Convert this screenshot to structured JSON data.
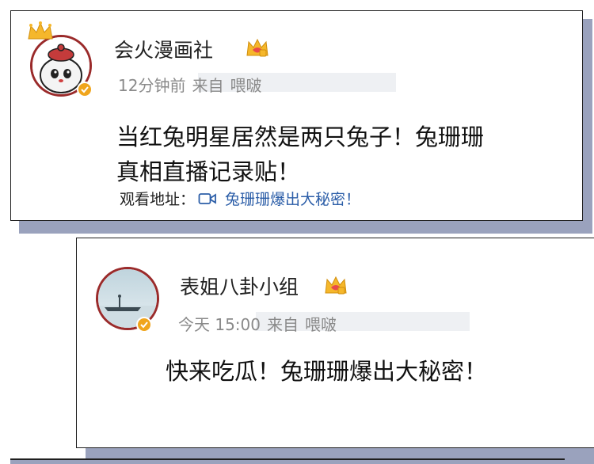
{
  "post1": {
    "username": "会火漫画社",
    "time": "12分钟前",
    "from_label": "来自",
    "source": "喂啵",
    "text_line1": "当红兔明星居然是两只兔子！兔珊珊",
    "text_line2": "真相直播记录贴！",
    "watch_label": "观看地址：",
    "watch_link": "兔珊珊爆出大秘密！"
  },
  "post2": {
    "username": "表姐八卦小组",
    "time": "今天 15:00",
    "from_label": "来自",
    "source": "喂啵",
    "text": "快来吃瓜！兔珊珊爆出大秘密！"
  },
  "colors": {
    "link": "#2c5ea8",
    "verified": "#f0a51d",
    "crown": "#f0a51d",
    "shadow": "#9aa2bd"
  }
}
